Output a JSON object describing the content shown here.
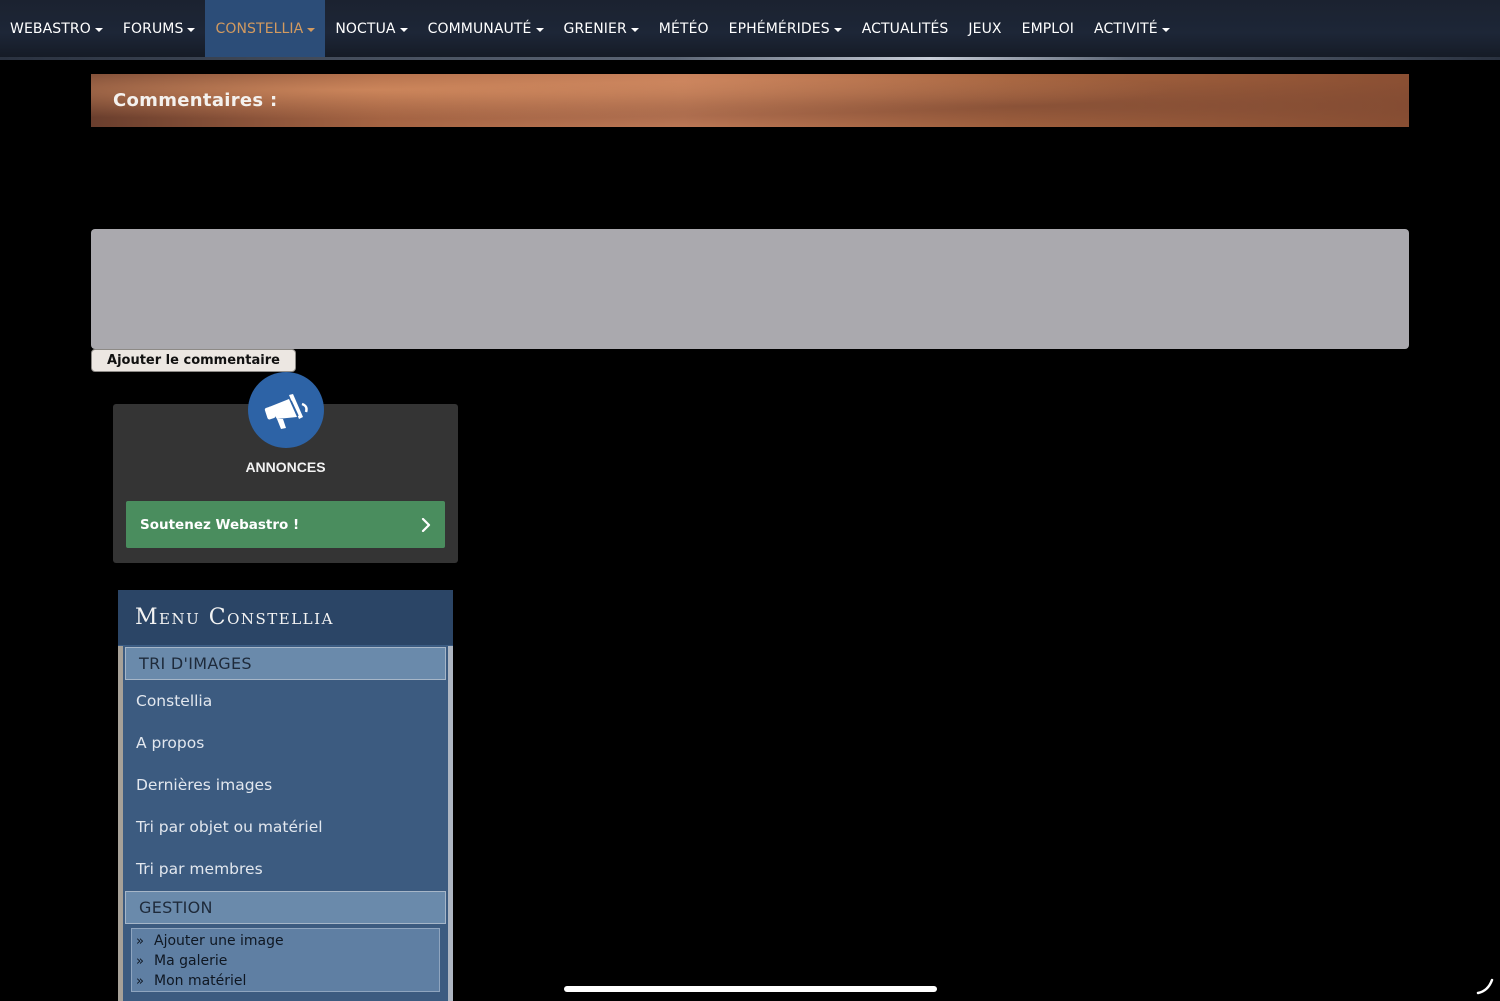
{
  "nav": {
    "items": [
      {
        "label": "WEBASTRO",
        "caret": true
      },
      {
        "label": "FORUMS",
        "caret": true
      },
      {
        "label": "CONSTELLIA",
        "caret": true,
        "active": true
      },
      {
        "label": "NOCTUA",
        "caret": true
      },
      {
        "label": "COMMUNAUTÉ",
        "caret": true
      },
      {
        "label": "GRENIER",
        "caret": true
      },
      {
        "label": "MÉTÉO",
        "caret": false
      },
      {
        "label": "EPHÉMÉRIDES",
        "caret": true
      },
      {
        "label": "ACTUALITÉS",
        "caret": false
      },
      {
        "label": "JEUX",
        "caret": false
      },
      {
        "label": "EMPLOI",
        "caret": false
      },
      {
        "label": "ACTIVITÉ",
        "caret": true
      }
    ]
  },
  "comments": {
    "title": "Commentaires :",
    "textarea_value": "",
    "submit_label": "Ajouter le commentaire"
  },
  "announcements": {
    "icon": "megaphone-icon",
    "title": "ANNONCES",
    "support_label": "Soutenez Webastro !",
    "support_icon": "chevron-right-icon"
  },
  "menu": {
    "title": "Menu Constellia",
    "sections": {
      "tri": {
        "title": "TRI D'IMAGES",
        "items": [
          "Constellia",
          "A propos",
          "Dernières images",
          "Tri par objet ou matériel",
          "Tri par membres"
        ]
      },
      "gestion": {
        "title": "GESTION",
        "items": [
          "Ajouter une image",
          "Ma galerie",
          "Mon matériel"
        ]
      }
    }
  },
  "colors": {
    "nav_active_bg": "#2c4d78",
    "nav_active_text": "#d39a5f",
    "support_green": "#4a8d5e",
    "announce_blue": "#2d63a6",
    "menu_blue": "#304c6f"
  }
}
